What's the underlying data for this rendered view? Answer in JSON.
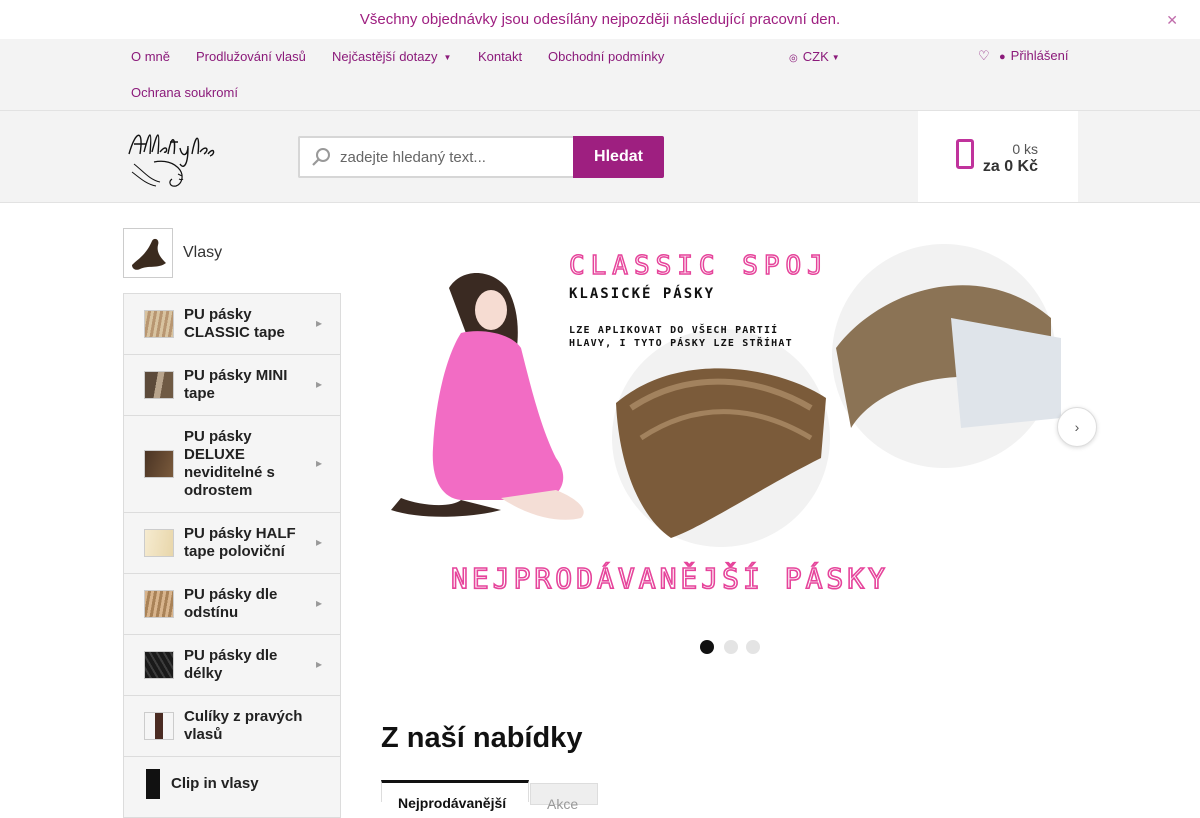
{
  "announcement": {
    "text": "Všechny objednávky jsou odesílány nejpozději následující pracovní den.",
    "close_label": "✕"
  },
  "topnav": {
    "items": [
      {
        "label": "O mně"
      },
      {
        "label": "Prodlužování vlasů"
      },
      {
        "label": "Nejčastější dotazy"
      },
      {
        "label": "Kontakt"
      },
      {
        "label": "Obchodní podmínky"
      },
      {
        "label": "Ochrana soukromí"
      }
    ],
    "currency": "CZK",
    "login": "Přihlášení"
  },
  "header": {
    "logo_text": "Alltstyles",
    "search_placeholder": "zadejte hledaný text...",
    "search_button": "Hledat",
    "cart_count": "0 ks",
    "cart_total": "za 0 Kč"
  },
  "sidebar": {
    "category_title": "Vlasy",
    "items": [
      {
        "label": "PU pásky CLASSIC tape",
        "thumb": "#c8ab88"
      },
      {
        "label": "PU pásky MINI tape",
        "thumb": "#7d6650"
      },
      {
        "label": "PU pásky DELUXE neviditelné s odrostem",
        "thumb": "#5a3f2c"
      },
      {
        "label": "PU pásky HALF tape poloviční",
        "thumb": "#f0e2c2"
      },
      {
        "label": "PU pásky dle odstínu",
        "thumb": "#c8a27c"
      },
      {
        "label": "PU pásky dle délky",
        "thumb": "#2a2a2a"
      },
      {
        "label": "Culíky z pravých vlasů",
        "thumb": "#4a2b22"
      },
      {
        "label": "Clip in vlasy",
        "thumb": "#111111"
      }
    ]
  },
  "banner": {
    "title": "CLASSIC SPOJ",
    "subtitle": "KLASICKÉ PÁSKY",
    "line1": "LZE APLIKOVAT DO VŠECH PARTIÍ",
    "line2": "HLAVY, I TYTO PÁSKY LZE STŘÍHAT",
    "footer": "NEJPRODÁVANĚJŠÍ PÁSKY",
    "slide_count": 3,
    "active_slide": 1
  },
  "offer": {
    "title": "Z naší nabídky",
    "tabs": [
      {
        "label": "Nejprodávanější"
      },
      {
        "label": "Akce"
      }
    ]
  },
  "colors": {
    "accent": "#9e1f80",
    "cart_icon": "#c0339c",
    "neon_pink": "#e6449b"
  }
}
